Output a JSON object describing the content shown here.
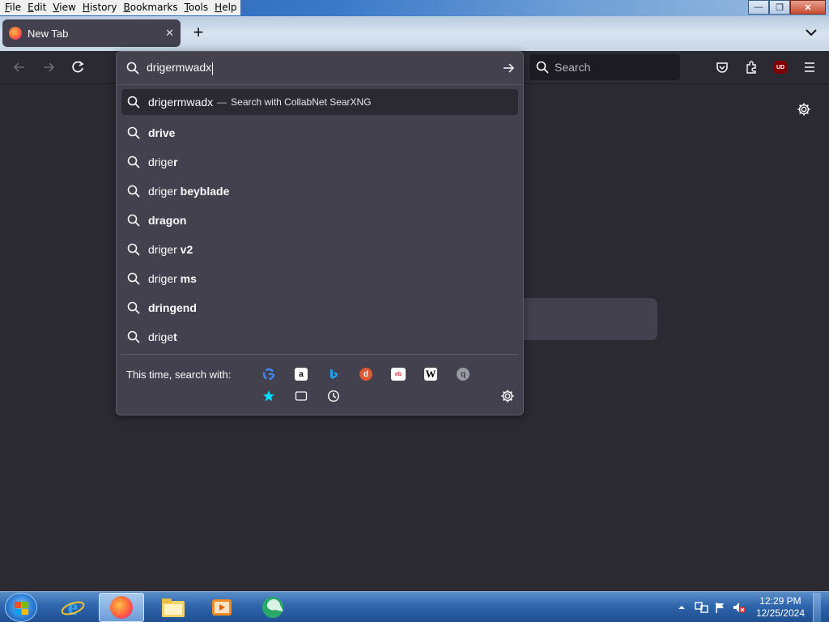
{
  "menubar": {
    "items": [
      {
        "label": "File",
        "accel": "F",
        "rest": "ile"
      },
      {
        "label": "Edit",
        "accel": "E",
        "rest": "dit"
      },
      {
        "label": "View",
        "accel": "V",
        "rest": "iew"
      },
      {
        "label": "History",
        "accel": "H",
        "rest": "istory"
      },
      {
        "label": "Bookmarks",
        "accel": "B",
        "rest": "ookmarks"
      },
      {
        "label": "Tools",
        "accel": "T",
        "rest": "ools"
      },
      {
        "label": "Help",
        "accel": "H",
        "rest": "elp"
      }
    ]
  },
  "window_controls": {
    "minimize": "—",
    "maximize": "❐",
    "close": "✕"
  },
  "tab": {
    "title": "New Tab",
    "close": "✕"
  },
  "newtab_button": "+",
  "navbar": {
    "search_placeholder": "Search",
    "ublock_label": "UD"
  },
  "urlbar": {
    "typed": "drigermwadx",
    "first_row": {
      "text": "drigermwadx",
      "separator": "—",
      "action": "Search with CollabNet SearXNG"
    },
    "suggestions": [
      {
        "plain": "",
        "bold": "drive"
      },
      {
        "plain": "drige",
        "bold": "r"
      },
      {
        "plain": "driger",
        "bold": " beyblade"
      },
      {
        "plain": "",
        "bold": "dragon"
      },
      {
        "plain": "driger",
        "bold": " v2"
      },
      {
        "plain": "driger",
        "bold": " ms"
      },
      {
        "plain": "",
        "bold": "dringend"
      },
      {
        "plain": "drige",
        "bold": "t"
      }
    ],
    "one_off_label": "This time, search with:",
    "engines": [
      "google-icon",
      "amazon-icon",
      "bing-icon",
      "duckduckgo-icon",
      "ebay-icon",
      "wikipedia-icon",
      "searxng-icon"
    ],
    "modes": [
      "bookmarks-icon",
      "tabs-icon",
      "history-icon"
    ]
  },
  "taskbar": {
    "time": "12:29 PM",
    "date": "12/25/2024"
  },
  "colors": {
    "bg": "#2b2a33",
    "panel": "#42414d",
    "accent": "#00ddff"
  }
}
